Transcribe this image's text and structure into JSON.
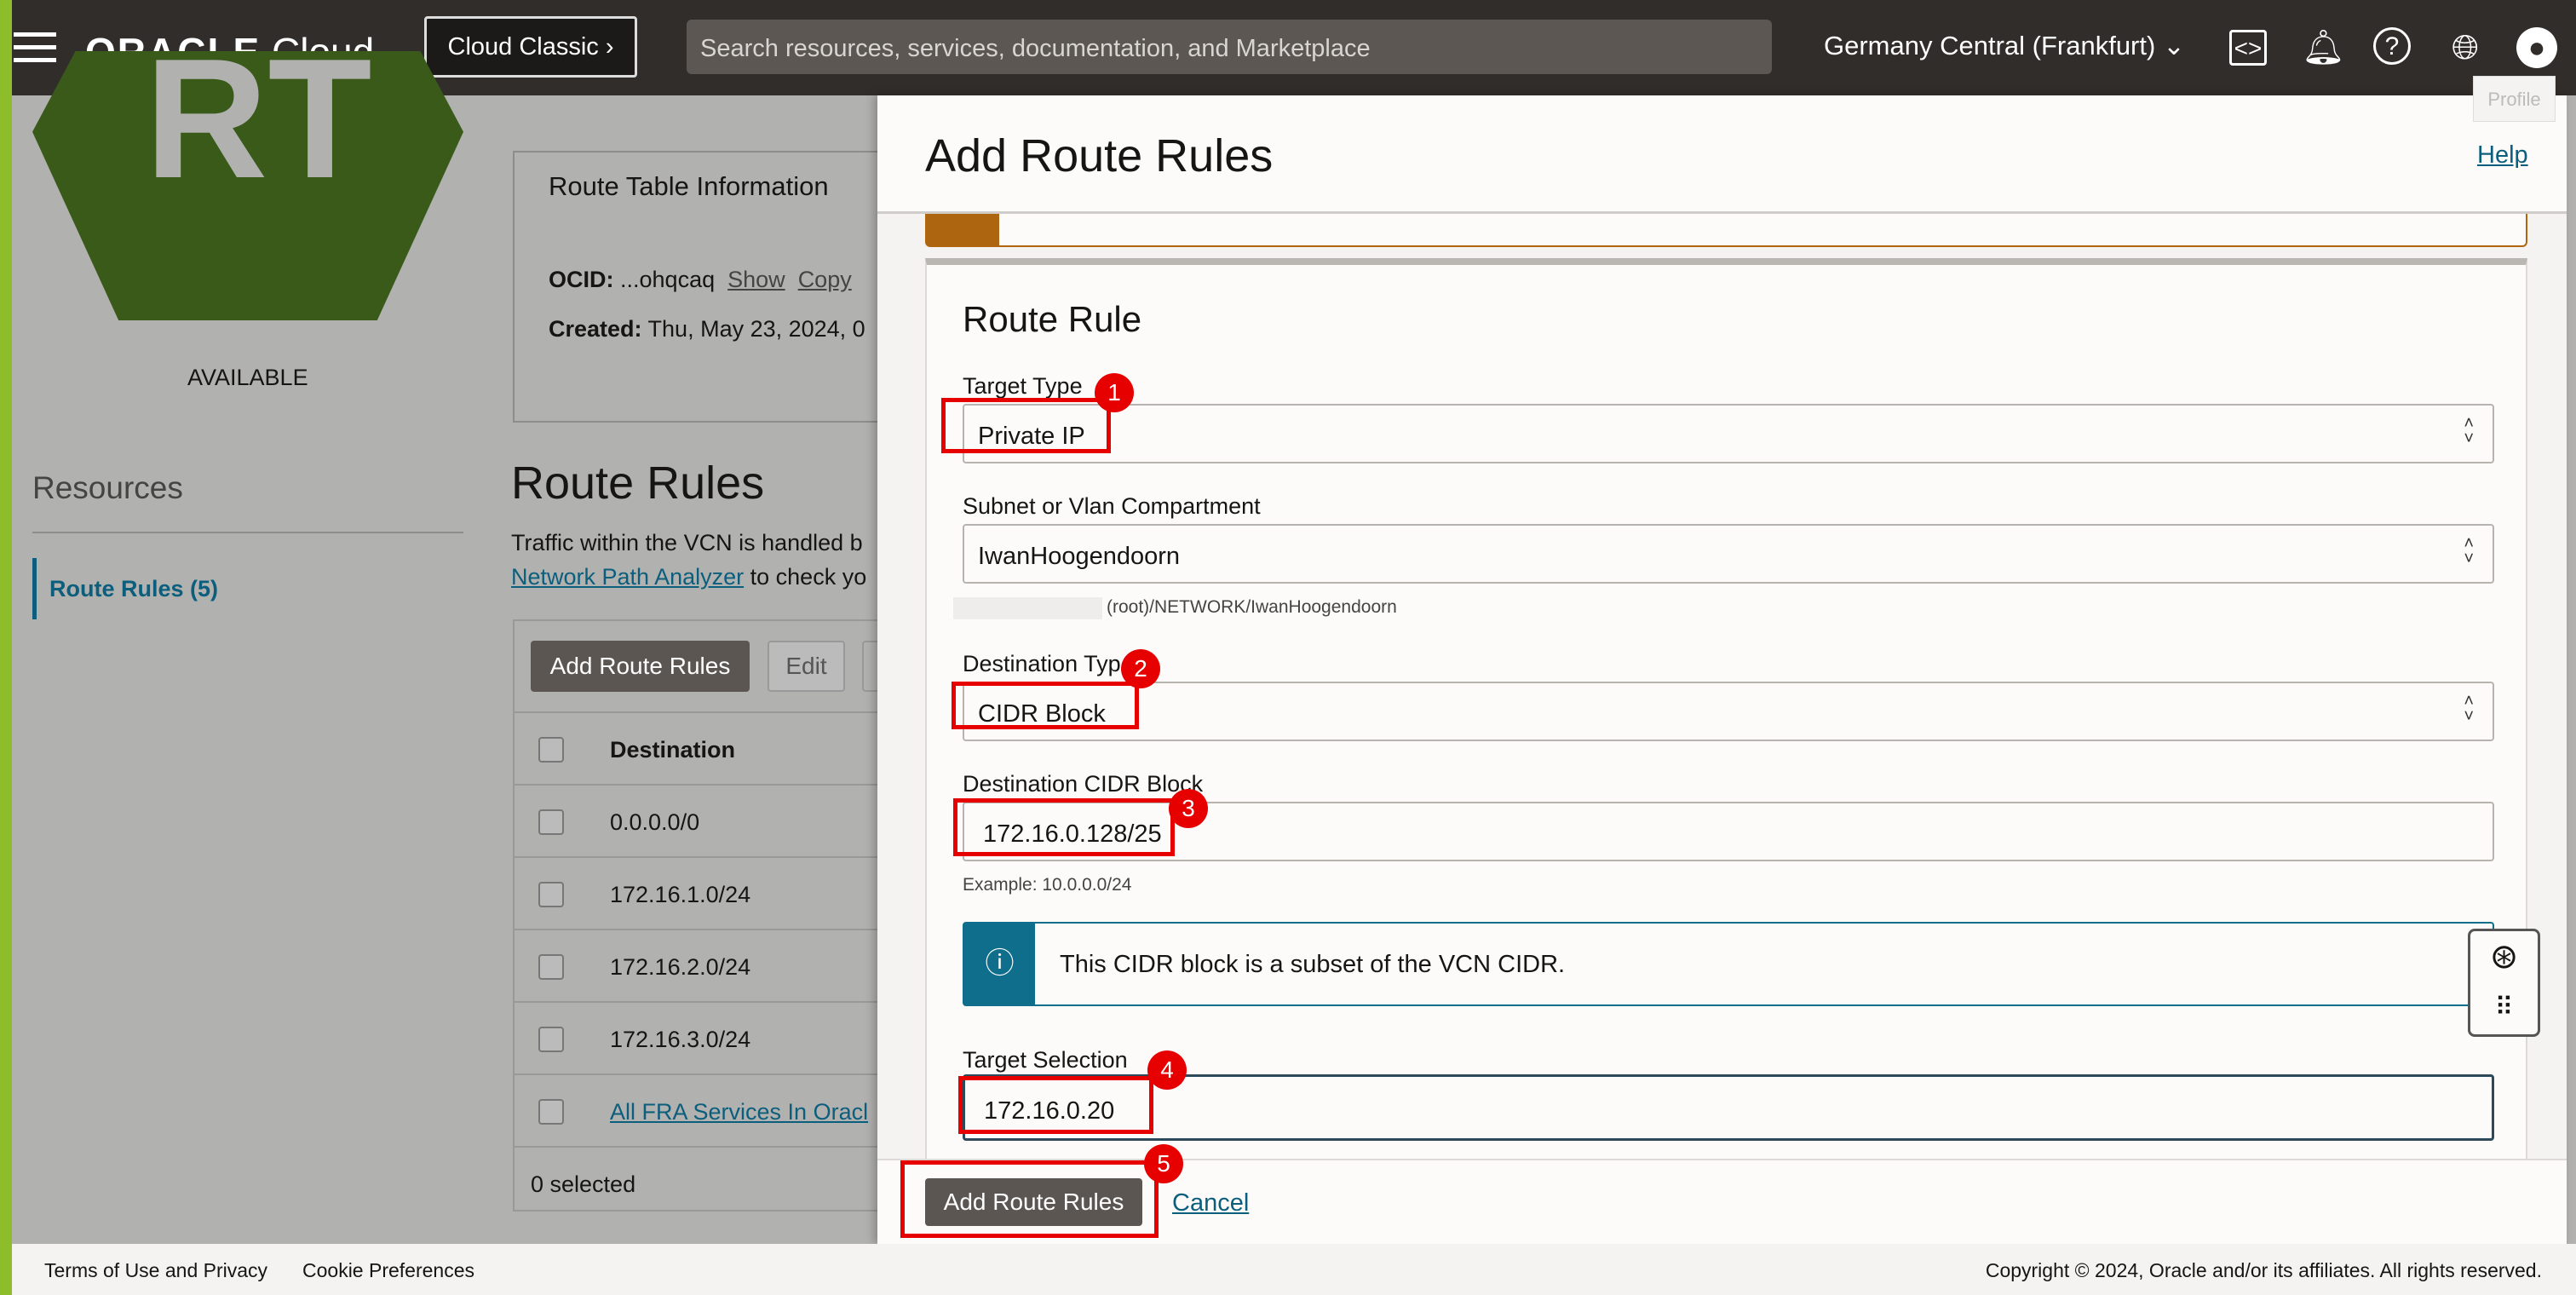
{
  "header": {
    "logo_brand": "ORACLE",
    "logo_product": "Cloud",
    "cloud_classic": "Cloud Classic ›",
    "search_placeholder": "Search resources, services, documentation, and Marketplace",
    "region": "Germany Central (Frankfurt)",
    "profile_tooltip": "Profile"
  },
  "resource": {
    "icon_text": "RT",
    "status": "AVAILABLE"
  },
  "info": {
    "title": "Route Table Information",
    "ocid_label": "OCID:",
    "ocid_value": "...ohqcaq",
    "show": "Show",
    "copy": "Copy",
    "created_label": "Created:",
    "created_value": "Thu, May 23, 2024, 0"
  },
  "sidebar": {
    "heading": "Resources",
    "items": [
      {
        "label": "Route Rules (5)"
      }
    ]
  },
  "main": {
    "title": "Route Rules",
    "desc": "Traffic within the VCN is handled b",
    "desc_link": "Network Path Analyzer",
    "desc_tail": "to check yo",
    "add_button": "Add Route Rules",
    "edit_button": "Edit",
    "column": "Destination",
    "rows": [
      "0.0.0.0/0",
      "172.16.1.0/24",
      "172.16.2.0/24",
      "172.16.3.0/24",
      "All FRA Services In Oracl"
    ],
    "selected": "0 selected"
  },
  "panel": {
    "title": "Add Route Rules",
    "help": "Help",
    "card_title": "Route Rule",
    "target_type_label": "Target Type",
    "target_type": "Private IP",
    "compartment_label": "Subnet or Vlan Compartment",
    "compartment": "IwanHoogendoorn",
    "compartment_path": "(root)/NETWORK/IwanHoogendoorn",
    "dest_type_label": "Destination Type",
    "dest_type": "CIDR Block",
    "cidr_label": "Destination CIDR Block",
    "cidr": "172.16.0.128/25",
    "cidr_example": "Example: 10.0.0.0/24",
    "info_msg": "This CIDR block is a subset of the VCN CIDR.",
    "target_sel_label": "Target Selection",
    "target_sel": "172.16.0.20",
    "submit": "Add Route Rules",
    "cancel": "Cancel"
  },
  "annotations": [
    "1",
    "2",
    "3",
    "4",
    "5"
  ],
  "footer": {
    "terms": "Terms of Use and Privacy",
    "cookies": "Cookie Preferences",
    "copyright": "Copyright © 2024, Oracle and/or its affiliates. All rights reserved."
  }
}
